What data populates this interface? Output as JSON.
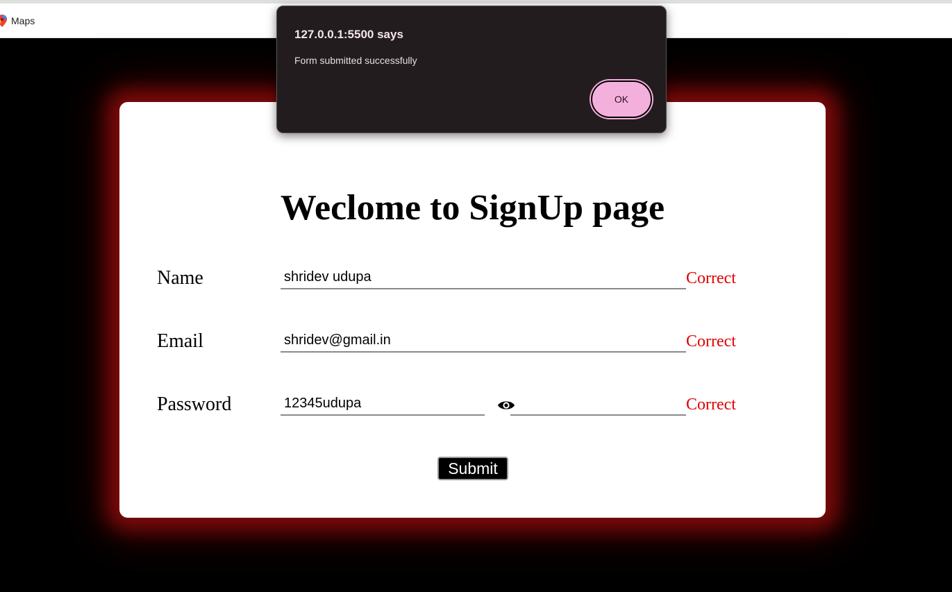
{
  "browser": {
    "bookmarks": [
      {
        "label": "Maps",
        "icon": "maps-pin-icon"
      }
    ]
  },
  "page": {
    "title": "Weclome to SignUp page",
    "form": {
      "name": {
        "label": "Name",
        "value": "shridev udupa",
        "status": "Correct"
      },
      "email": {
        "label": "Email",
        "value": "shridev@gmail.in",
        "status": "Correct"
      },
      "password": {
        "label": "Password",
        "value": "12345udupa",
        "status": "Correct",
        "toggle_icon": "eye-icon"
      },
      "submit_label": "Submit"
    }
  },
  "dialog": {
    "title": "127.0.0.1:5500 says",
    "message": "Form submitted successfully",
    "ok_label": "OK"
  },
  "colors": {
    "background": "#000000",
    "card": "#ffffff",
    "card_glow": "#8c0c0c",
    "status": "#e00000",
    "dialog_bg": "#231c1f",
    "ok_button": "#f4b0dc"
  }
}
